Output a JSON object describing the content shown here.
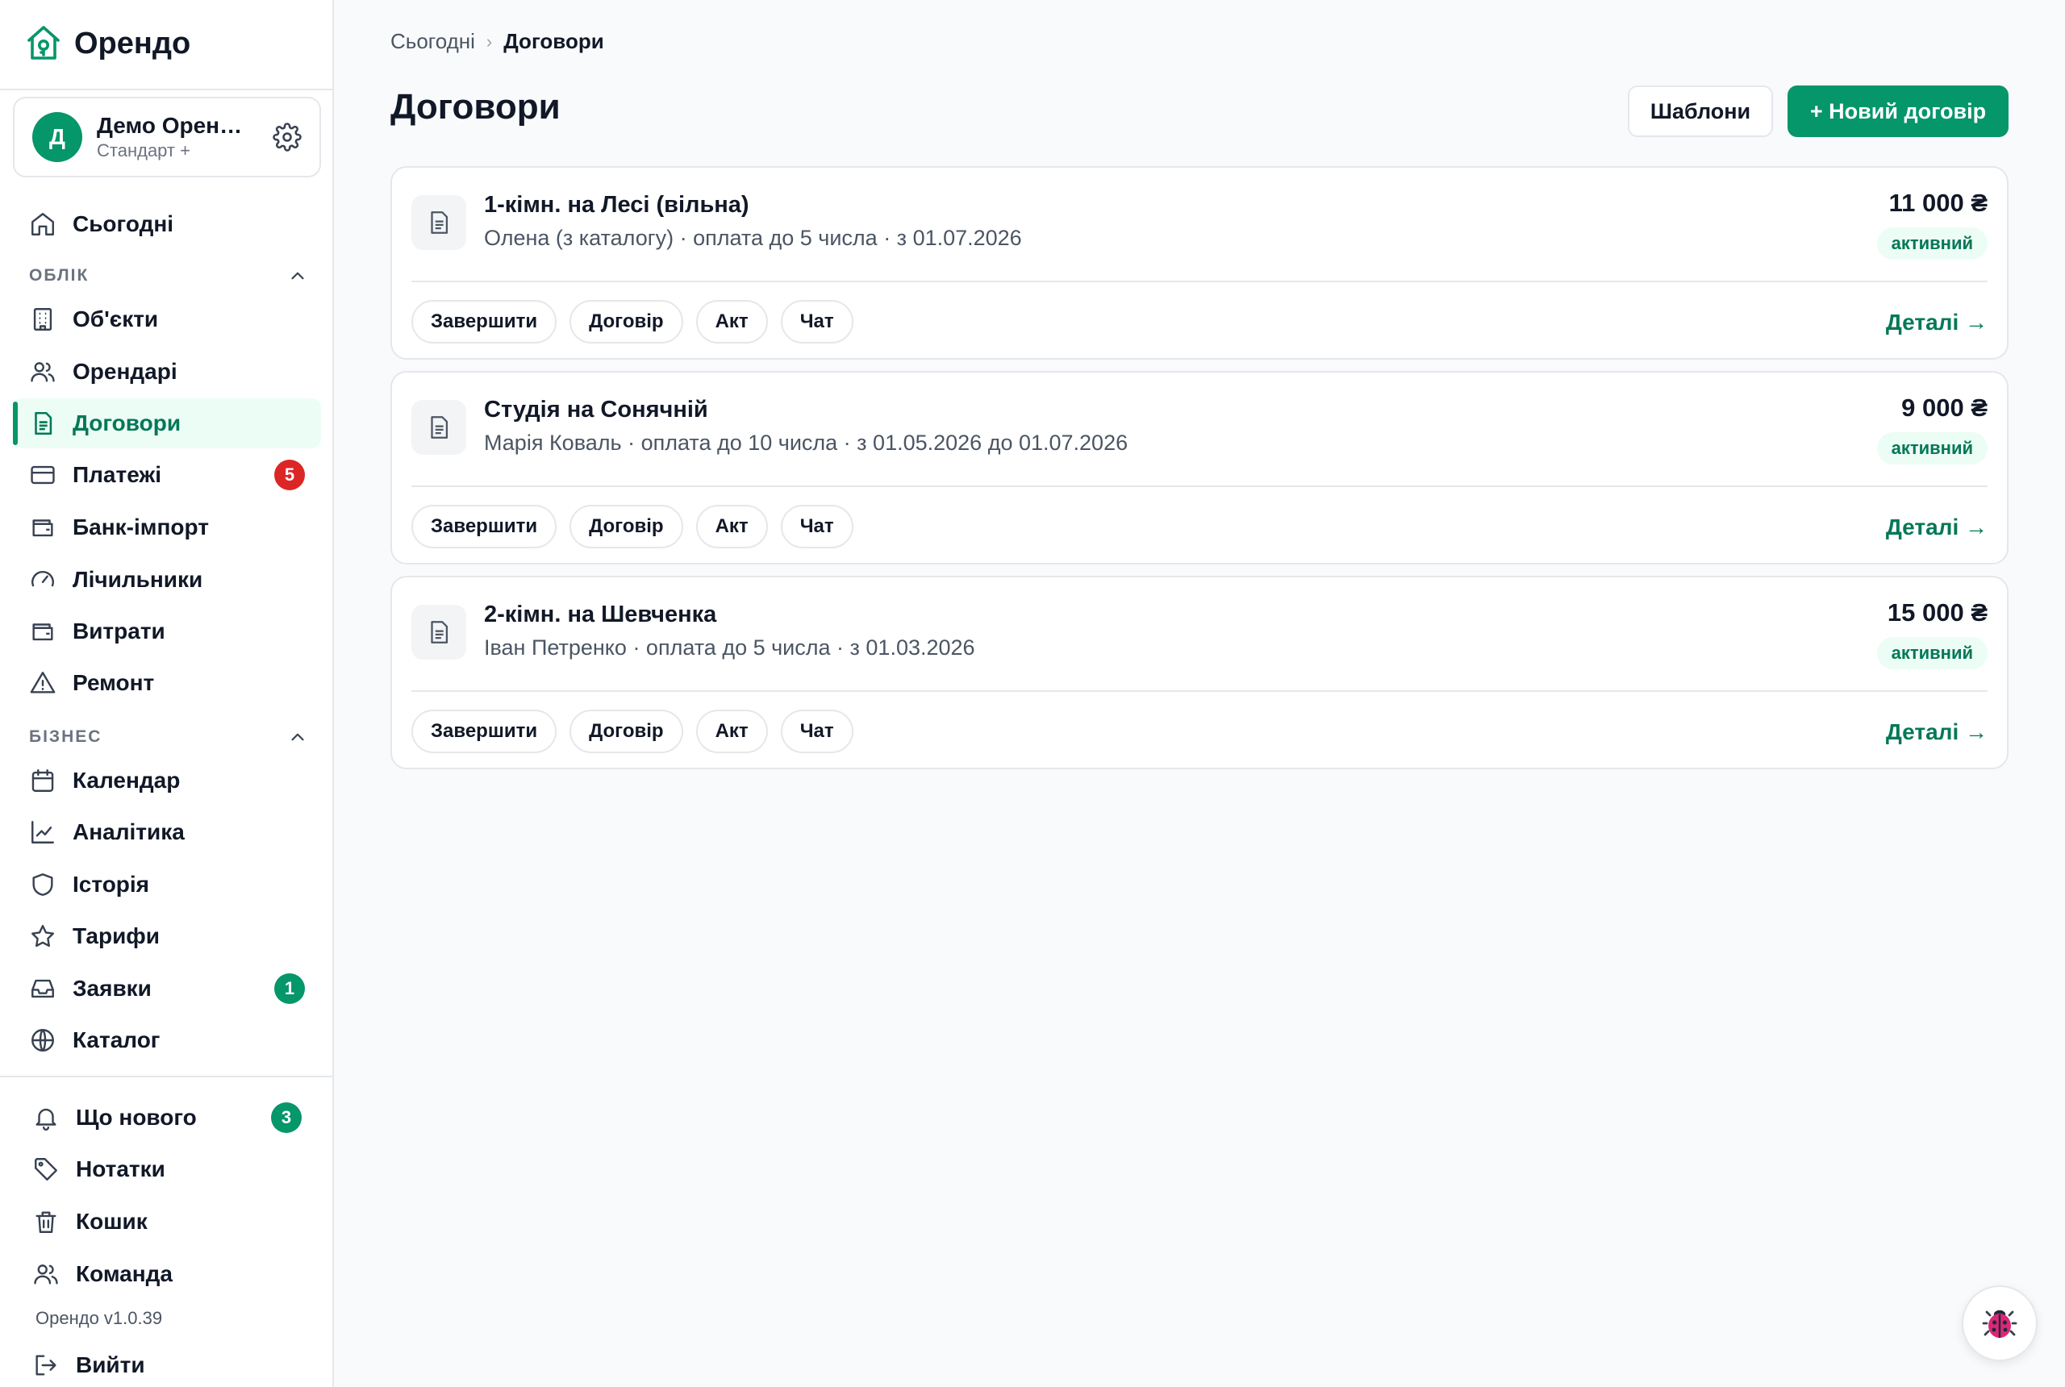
{
  "app": {
    "name": "Орендо",
    "version": "Орендо v1.0.39"
  },
  "org": {
    "initial": "Д",
    "name": "Демо Орен…",
    "plan": "Стандарт +"
  },
  "nav": {
    "today": "Сьогодні",
    "section_accounting": "ОБЛІК",
    "properties": "Об'єкти",
    "tenants": "Орендарі",
    "contracts": "Договори",
    "payments": "Платежі",
    "payments_badge": "5",
    "bank_import": "Банк-імпорт",
    "meters": "Лічильники",
    "expenses": "Витрати",
    "repairs": "Ремонт",
    "section_business": "БІЗНЕС",
    "calendar": "Календар",
    "analytics": "Аналітика",
    "history": "Історія",
    "tariffs": "Тарифи",
    "requests": "Заявки",
    "requests_badge": "1",
    "catalog": "Каталог",
    "whats_new": "Що нового",
    "whats_new_badge": "3",
    "notes": "Нотатки",
    "trash": "Кошик",
    "team": "Команда",
    "logout": "Вийти"
  },
  "breadcrumb": {
    "home": "Сьогодні",
    "current": "Договори"
  },
  "page": {
    "title": "Договори",
    "templates_button": "Шаблони",
    "new_button": "+ Новий договір"
  },
  "actions": {
    "finish": "Завершити",
    "contract": "Договір",
    "act": "Акт",
    "chat": "Чат",
    "details": "Деталі →"
  },
  "contracts": [
    {
      "title": "1-кімн. на Лесі (вільна)",
      "subtitle": "Олена (з каталогу) · оплата до 5 числа · з 01.07.2026",
      "amount": "11 000 ₴",
      "status": "активний"
    },
    {
      "title": "Студія на Сонячній",
      "subtitle": "Марія Коваль · оплата до 10 числа · з 01.05.2026 до 01.07.2026",
      "amount": "9 000 ₴",
      "status": "активний"
    },
    {
      "title": "2-кімн. на Шевченка",
      "subtitle": "Іван Петренко · оплата до 5 числа · з 01.03.2026",
      "amount": "15 000 ₴",
      "status": "активний"
    }
  ],
  "colors": {
    "brand": "#059669",
    "brand_dark": "#047857",
    "badge_red": "#dc2626",
    "active_bg": "#ecfdf5"
  }
}
